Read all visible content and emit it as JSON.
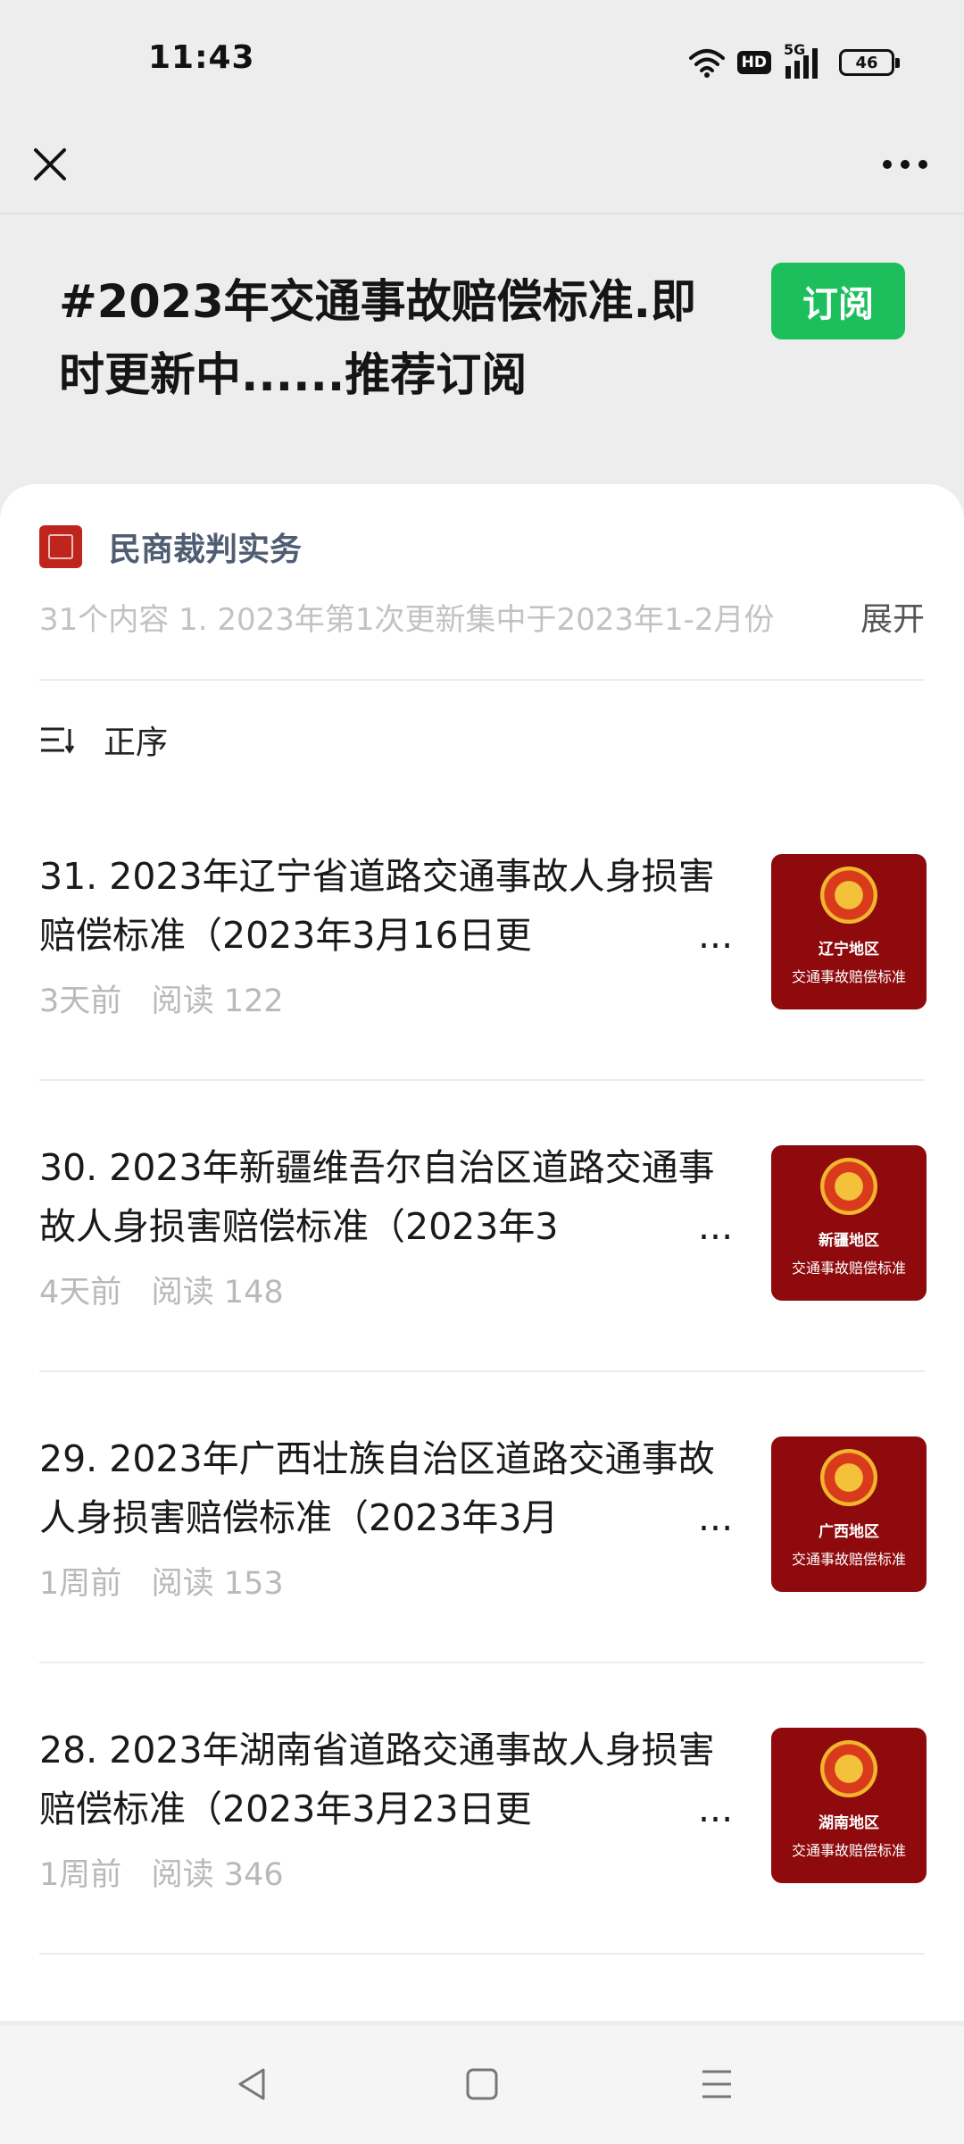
{
  "status_bar": {
    "time": "11:43",
    "hd_label": "HD",
    "network_label": "5G",
    "battery_level": "46"
  },
  "nav": {
    "close_icon": "close-icon",
    "more_icon": "more-icon"
  },
  "collection": {
    "title": "#2023年交通事故赔偿标准.即时更新中......推荐订阅",
    "subscribe_label": "订阅",
    "subscribe_color": "#1dbf5c"
  },
  "account": {
    "name": "民商裁判实务"
  },
  "summary": {
    "text": "31个内容  1. 2023年第1次更新集中于2023年1-2月份",
    "expand_label": "展开"
  },
  "sort": {
    "label": "正序",
    "icon": "sort-icon"
  },
  "articles": [
    {
      "title": "31. 2023年辽宁省道路交通事故人身损害赔偿标准（2023年3月16日更",
      "time": "3天前",
      "reads": "阅读 122",
      "thumb_region": "辽宁地区",
      "thumb_sub": "交通事故赔偿标准"
    },
    {
      "title": "30. 2023年新疆维吾尔自治区道路交通事故人身损害赔偿标准（2023年3",
      "time": "4天前",
      "reads": "阅读 148",
      "thumb_region": "新疆地区",
      "thumb_sub": "交通事故赔偿标准"
    },
    {
      "title": "29. 2023年广西壮族自治区道路交通事故人身损害赔偿标准（2023年3月",
      "time": "1周前",
      "reads": "阅读 153",
      "thumb_region": "广西地区",
      "thumb_sub": "交通事故赔偿标准"
    },
    {
      "title": "28. 2023年湖南省道路交通事故人身损害赔偿标准（2023年3月23日更",
      "time": "1周前",
      "reads": "阅读 346",
      "thumb_region": "湖南地区",
      "thumb_sub": "交通事故赔偿标准"
    }
  ],
  "ellipsis": "...",
  "system_nav": {
    "back_icon": "back-triangle-icon",
    "home_icon": "home-square-icon",
    "menu_icon": "menu-lines-icon"
  }
}
